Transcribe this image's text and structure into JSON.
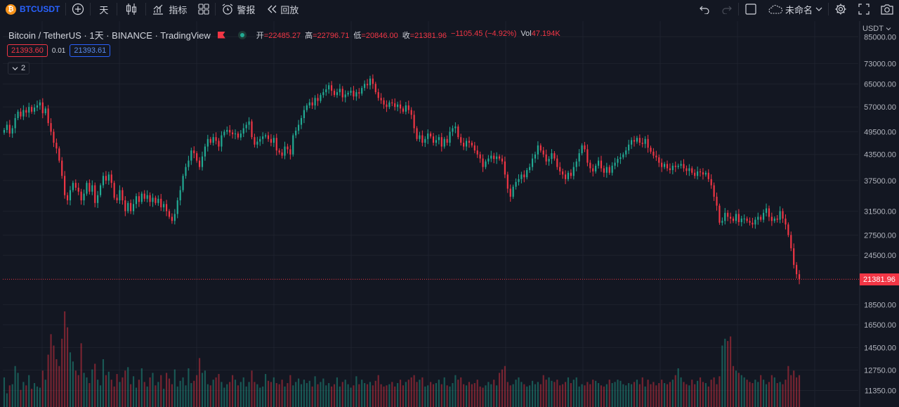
{
  "toolbar": {
    "symbol": "BTCUSDT",
    "coin_icon": "bitcoin-icon",
    "add_icon": "plus-circle-icon",
    "interval": "天",
    "chart_type_icon": "candles-icon",
    "indicators_label": "指标",
    "indicators_icon": "indicator-chart-icon",
    "layouts_icon": "grid-icon",
    "alert_label": "警报",
    "alert_icon": "alarm-clock-icon",
    "replay_label": "回放",
    "replay_icon": "rewind-icon",
    "undo_icon": "undo-icon",
    "redo_icon": "redo-icon",
    "layout_icon": "square-icon",
    "layout_name": "未命名",
    "cloud_icon": "cloud-icon",
    "settings_icon": "gear-icon",
    "fullscreen_icon": "fullscreen-icon",
    "snapshot_icon": "camera-icon"
  },
  "legend": {
    "title": "Bitcoin / TetherUS · 1天 · BINANCE · TradingView",
    "open_label": "开",
    "open": "=22485.27",
    "high_label": "高",
    "high": "=22796.71",
    "low_label": "低",
    "low": "=20846.00",
    "close_label": "收",
    "close": "=21381.96",
    "change": "−1105.45 (−4.92%)",
    "vol_label": "Vol",
    "vol": "47.194K"
  },
  "quote": {
    "sell": "21393.60",
    "spread": "0.01",
    "buy": "21393.61"
  },
  "indicators_toggle": "2",
  "price_axis": {
    "unit": "USDT",
    "ticks": [
      "85000.00",
      "73000.00",
      "65000.00",
      "57000.00",
      "49500.00",
      "43500.00",
      "37500.00",
      "31500.00",
      "27500.00",
      "24500.00",
      "18500.00",
      "16500.00",
      "14500.00",
      "12750.00",
      "11350.00"
    ],
    "last_price": "21381.96"
  },
  "colors": {
    "up": "#22ab94",
    "down": "#f23645",
    "background": "#131722",
    "grid": "#1e222d"
  },
  "chart_data": {
    "type": "candlestick",
    "symbol": "BTCUSDT",
    "log_scale": true,
    "ylim": [
      10500,
      90000
    ],
    "last_price": 21381.96,
    "close_series": [
      50000,
      51500,
      49000,
      50500,
      53500,
      55500,
      54000,
      56000,
      55200,
      57000,
      55500,
      56800,
      57500,
      58500,
      55000,
      56500,
      52000,
      49500,
      46500,
      45000,
      42000,
      38500,
      34500,
      33500,
      35500,
      37000,
      36000,
      35200,
      33500,
      34800,
      37000,
      35200,
      36500,
      33000,
      34500,
      36500,
      38500,
      37500,
      38800,
      37000,
      34000,
      33500,
      35500,
      33500,
      31500,
      33000,
      31500,
      32800,
      34300,
      33200,
      34800,
      33800,
      34500,
      33200,
      34000,
      33000,
      33800,
      32200,
      32800,
      31500,
      30500,
      29800,
      31000,
      33500,
      35500,
      38500,
      40500,
      42000,
      44500,
      43800,
      42000,
      40500,
      43000,
      45500,
      47500,
      46500,
      48000,
      47000,
      45500,
      48500,
      49500,
      50000,
      49300,
      48800,
      49000,
      47900,
      49000,
      50500,
      51500,
      52500,
      48000,
      46000,
      46800,
      47500,
      48200,
      48500,
      47500,
      46500,
      47800,
      44500,
      44000,
      43200,
      45500,
      44800,
      43500,
      48500,
      49800,
      51500,
      53500,
      56000,
      57500,
      58500,
      57500,
      60000,
      59000,
      61000,
      62000,
      63000,
      64500,
      62500,
      61000,
      62000,
      63200,
      60200,
      61200,
      61800,
      62500,
      60500,
      62000,
      61500,
      63500,
      65000,
      64500,
      67000,
      65000,
      62000,
      60000,
      59200,
      57800,
      57000,
      58500,
      58200,
      57000,
      57800,
      56500,
      55500,
      57500,
      56000,
      54500,
      50500,
      47500,
      48500,
      46500,
      47500,
      49000,
      48200,
      46500,
      47200,
      48000,
      45500,
      47500,
      46500,
      49500,
      50500,
      51000,
      48000,
      46500,
      45500,
      47000,
      46500,
      45800,
      44500,
      43500,
      42500,
      40500,
      41800,
      42500,
      43200,
      42400,
      43000,
      42500,
      41800,
      38800,
      35800,
      34200,
      36200,
      37200,
      37800,
      38800,
      38200,
      39800,
      40500,
      42500,
      43500,
      45800,
      44500,
      43500,
      41800,
      42400,
      43800,
      42500,
      40500,
      39500,
      38800,
      37800,
      39200,
      38500,
      40500,
      41800,
      43800,
      45800,
      44800,
      41500,
      40200,
      39500,
      40800,
      42000,
      40200,
      39200,
      40500,
      39200,
      40800,
      41500,
      42400,
      42800,
      43500,
      44500,
      46000,
      47200,
      46800,
      47800,
      46500,
      46200,
      47500,
      45200,
      44200,
      43200,
      42800,
      41500,
      40500,
      41200,
      40200,
      39800,
      40800,
      40500,
      40800,
      41200,
      40200,
      39600,
      40200,
      39200,
      38500,
      39500,
      39300,
      38800,
      39200,
      37800,
      36500,
      34200,
      32500,
      29500,
      29800,
      31200,
      30500,
      30200,
      29800,
      31000,
      29600,
      30200,
      30200,
      29800,
      29500,
      29200,
      30000,
      30500,
      30000,
      31200,
      32000,
      30500,
      29800,
      30200,
      30000,
      31500,
      30200,
      29200,
      27500,
      25500,
      23200,
      22000,
      21381.96
    ],
    "volume_series": [
      130,
      60,
      95,
      100,
      180,
      150,
      75,
      110,
      95,
      140,
      80,
      105,
      90,
      85,
      160,
      120,
      230,
      320,
      270,
      210,
      180,
      300,
      420,
      350,
      240,
      200,
      160,
      140,
      280,
      150,
      130,
      105,
      165,
      190,
      120,
      95,
      210,
      140,
      155,
      120,
      90,
      145,
      110,
      130,
      160,
      175,
      100,
      135,
      85,
      120,
      170,
      110,
      90,
      130,
      150,
      95,
      110,
      140,
      80,
      150,
      125,
      100,
      165,
      90,
      115,
      130,
      95,
      170,
      105,
      115,
      140,
      215,
      150,
      160,
      100,
      95,
      120,
      130,
      145,
      110,
      85,
      100,
      110,
      140,
      120,
      95,
      110,
      130,
      90,
      110,
      160,
      110,
      100,
      85,
      90,
      145,
      115,
      110,
      130,
      105,
      100,
      120,
      90,
      105,
      140,
      95,
      110,
      125,
      100,
      120,
      105,
      115,
      90,
      135,
      100,
      110,
      125,
      95,
      105,
      90,
      100,
      130,
      90,
      110,
      120,
      100,
      85,
      95,
      135,
      100,
      120,
      105,
      100,
      110,
      95,
      115,
      140,
      100,
      90,
      95,
      100,
      110,
      90,
      105,
      120,
      95,
      110,
      120,
      130,
      140,
      110,
      120,
      130,
      90,
      95,
      110,
      100,
      105,
      120,
      100,
      130,
      95,
      90,
      105,
      140,
      120,
      130,
      100,
      95,
      110,
      100,
      105,
      120,
      90,
      85,
      95,
      110,
      100,
      120,
      95,
      150,
      165,
      180,
      110,
      95,
      100,
      120,
      130,
      110,
      100,
      90,
      95,
      115,
      100,
      110,
      100,
      140,
      120,
      130,
      115,
      110,
      120,
      95,
      100,
      110,
      130,
      105,
      120,
      130,
      90,
      100,
      95,
      110,
      100,
      120,
      115,
      105,
      95,
      90,
      100,
      120,
      105,
      110,
      120,
      115,
      100,
      95,
      105,
      100,
      110,
      120,
      100,
      130,
      90,
      120,
      100,
      110,
      95,
      105,
      120,
      105,
      100,
      110,
      120,
      140,
      170,
      130,
      110,
      100,
      95,
      120,
      100,
      115,
      130,
      110,
      105,
      90,
      120,
      130,
      100,
      135,
      270,
      300,
      290,
      310,
      180,
      160,
      150,
      140,
      130,
      120,
      110,
      105,
      120,
      110,
      140,
      120,
      100,
      110,
      140,
      130,
      105,
      110,
      100,
      120,
      180,
      140,
      160,
      130,
      140,
      230,
      190
    ]
  }
}
